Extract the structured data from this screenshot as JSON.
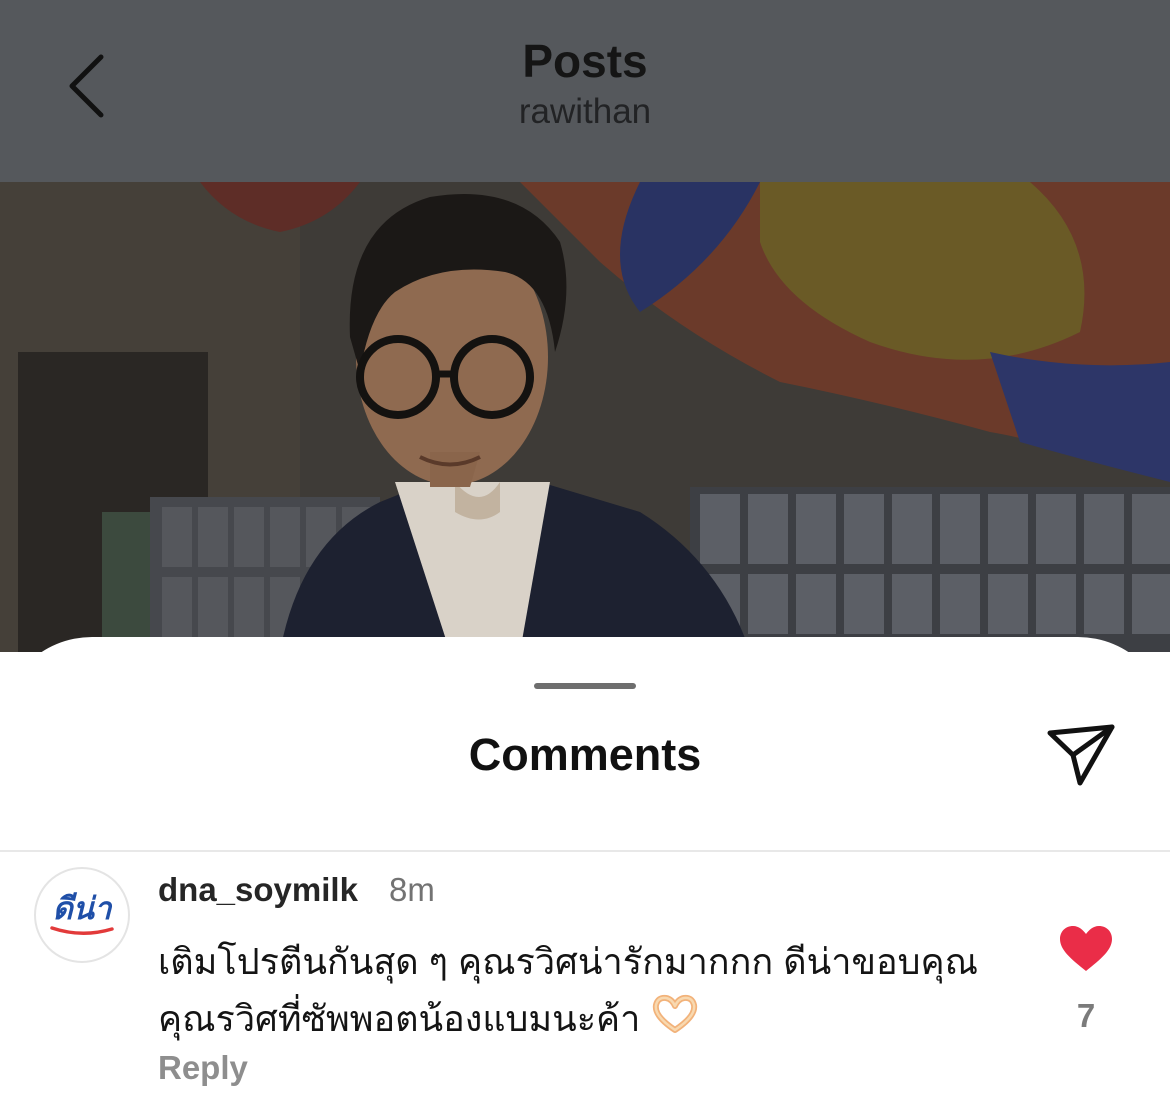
{
  "header": {
    "title": "Posts",
    "username": "rawithan",
    "back_icon": "chevron-left-icon"
  },
  "sheet": {
    "title": "Comments",
    "send_icon": "paper-plane-icon"
  },
  "comment": {
    "avatar_text": "ดีน่า",
    "username": "dna_soymilk",
    "time": "8m",
    "text": "เติมโปรตีนกันสุด ๆ คุณรวิศน่ารักมากกก ดีน่าขอบคุณคุณรวิศที่ซัพพอตน้องแบมนะค้า",
    "emoji": "heart-hands-emoji",
    "reply_label": "Reply",
    "like_icon": "heart-icon",
    "like_count": "7",
    "like_color": "#ea2d48"
  },
  "colors": {
    "header_bg": "#55585c",
    "sheet_bg": "#ffffff"
  }
}
